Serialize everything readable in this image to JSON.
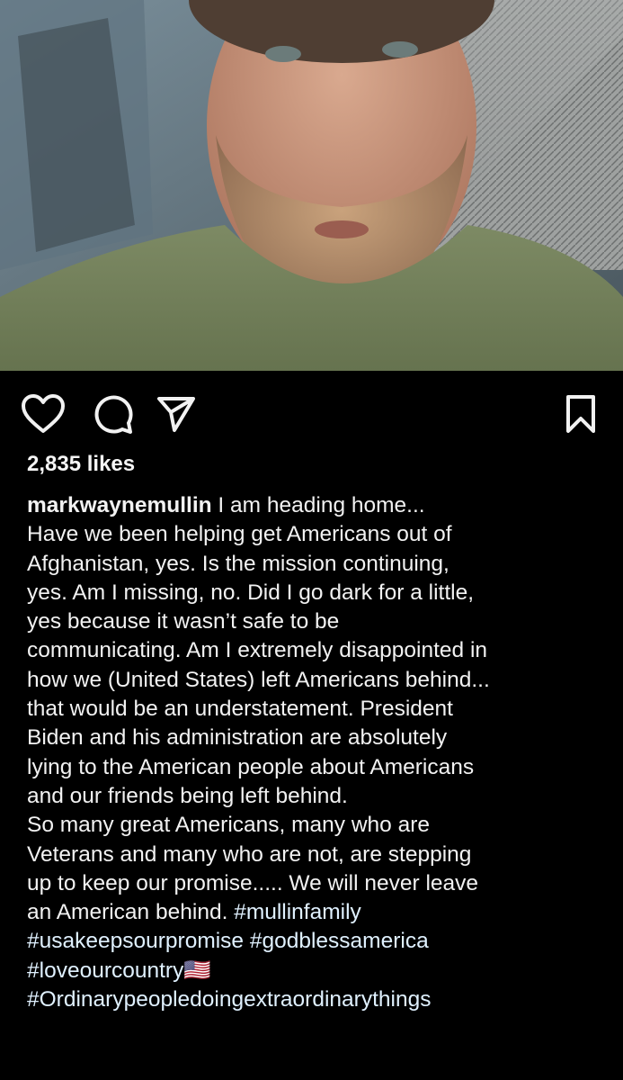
{
  "post": {
    "photo_alt": "selfie",
    "likes": "2,835 likes",
    "username": "markwaynemullin",
    "caption_first_line": " I am heading home...",
    "caption_body": "Have we been helping get Americans out of\nAfghanistan, yes. Is the mission continuing,\nyes. Am I missing, no. Did I go dark for a little,\nyes because it wasn’t safe to be\ncommunicating. Am I extremely disappointed in\nhow we (United States) left Americans behind...\nthat would be an understatement. President\nBiden and his administration are absolutely\nlying to the American people about Americans\nand our friends being left behind.\nSo many great Americans, many who are\nVeterans and many who are not, are stepping\nup to keep our promise..... We will never leave\nan American behind. ",
    "hashtags": "#mullinfamily\n#usakeepsourpromise #godblessamerica\n#loveourcountry🇺🇸\n#Ordinarypeopledoingextraordinarythings"
  },
  "icons": {
    "like": "heart-icon",
    "comment": "comment-icon",
    "share": "send-icon",
    "save": "bookmark-icon"
  }
}
